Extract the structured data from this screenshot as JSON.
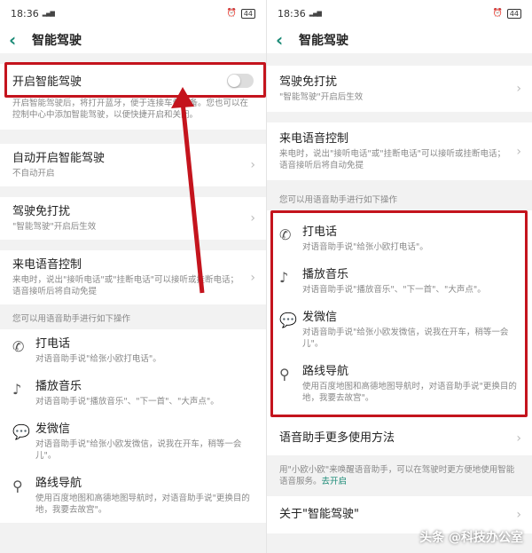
{
  "status": {
    "time": "18:36",
    "signal": "᷊ııl",
    "battery": "44"
  },
  "header": {
    "title": "智能驾驶"
  },
  "left": {
    "main_toggle": {
      "label": "开启智能驾驶"
    },
    "main_desc": "开启智能驾驶后，将打开蓝牙，便于连接车载设备。您也可以在控制中心中添加智能驾驶，以便快捷开启和关闭。",
    "auto": {
      "title": "自动开启智能驾驶",
      "sub": "不自动开启"
    },
    "hands_free": {
      "title": "驾驶免打扰",
      "sub": "\"智能驾驶\"开启后生效"
    },
    "call_voice": {
      "title": "来电语音控制",
      "sub": "来电时，说出\"接听电话\"或\"挂断电话\"可以接听或挂断电话；语音接听后将自动免提"
    },
    "section_label": "您可以用语音助手进行如下操作",
    "ops": [
      {
        "title": "打电话",
        "sub": "对语音助手说\"给张小欧打电话\"。"
      },
      {
        "title": "播放音乐",
        "sub": "对语音助手说\"播放音乐\"、\"下一首\"、\"大声点\"。"
      },
      {
        "title": "发微信",
        "sub": "对语音助手说\"给张小欧发微信，说我在开车，稍等一会儿\"。"
      },
      {
        "title": "路线导航",
        "sub": "使用百度地图和高德地图导航时，对语音助手说\"更换目的地，我要去故宫\"。"
      }
    ]
  },
  "right": {
    "hands_free": {
      "title": "驾驶免打扰",
      "sub": "\"智能驾驶\"开启后生效"
    },
    "call_voice": {
      "title": "来电语音控制",
      "sub": "来电时，说出\"接听电话\"或\"挂断电话\"可以接听或挂断电话；语音接听后将自动免提"
    },
    "section_label": "您可以用语音助手进行如下操作",
    "ops": [
      {
        "title": "打电话",
        "sub": "对语音助手说\"给张小欧打电话\"。"
      },
      {
        "title": "播放音乐",
        "sub": "对语音助手说\"播放音乐\"、\"下一首\"、\"大声点\"。"
      },
      {
        "title": "发微信",
        "sub": "对语音助手说\"给张小欧发微信，说我在开车，稍等一会儿\"。"
      },
      {
        "title": "路线导航",
        "sub": "使用百度地图和高德地图导航时，对语音助手说\"更换目的地，我要去故宫\"。"
      }
    ],
    "more": {
      "title": "语音助手更多使用方法"
    },
    "wake_desc": "用\"小欧小欧\"来唤醒语音助手，可以在驾驶时更方便地使用智能语音服务。",
    "wake_link": "去开启",
    "about": {
      "title": "关于\"智能驾驶\""
    }
  },
  "watermark": "头条 @科技办公室",
  "colors": {
    "accent": "#1a8a76",
    "highlight": "#c4141d"
  },
  "icons": {
    "phone": "phone-icon",
    "music": "music-note-icon",
    "wechat": "chat-bubble-icon",
    "nav": "location-pin-icon"
  }
}
